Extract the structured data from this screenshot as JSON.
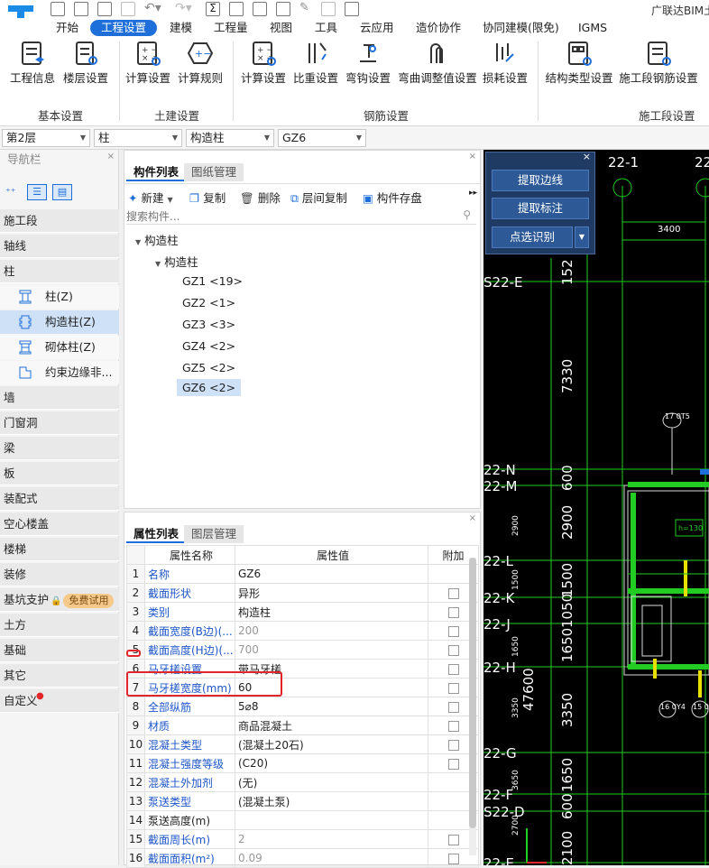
{
  "app_title": "广联达BIM土",
  "menu": {
    "tabs": [
      "开始",
      "工程设置",
      "建模",
      "工程量",
      "视图",
      "工具",
      "云应用",
      "造价协作",
      "协同建模(限免)",
      "IGMS"
    ],
    "active": "工程设置"
  },
  "ribbon": {
    "buttons": [
      "工程信息",
      "楼层设置",
      "计算设置",
      "计算规则",
      "计算设置",
      "比重设置",
      "弯钩设置",
      "弯曲调整值设置",
      "损耗设置",
      "结构类型设置",
      "施工段钢筋设置"
    ],
    "groups": [
      "基本设置",
      "土建设置",
      "钢筋设置",
      "施工段设置"
    ]
  },
  "filters": {
    "floor": "第2层",
    "type": "柱",
    "subtype": "构造柱",
    "item": "GZ6"
  },
  "nav": {
    "title": "导航栏",
    "categories_top": [
      "施工段",
      "轴线",
      "柱"
    ],
    "column_items": [
      "柱(Z)",
      "构造柱(Z)",
      "砌体柱(Z)",
      "约束边缘非..."
    ],
    "categories_bottom": [
      "墙",
      "门窗洞",
      "梁",
      "板",
      "装配式",
      "空心楼盖",
      "楼梯",
      "装修",
      "基坑支护",
      "土方",
      "基础",
      "其它",
      "自定义"
    ],
    "free_badge": "免费试用"
  },
  "complist": {
    "tabs": [
      "构件列表",
      "图纸管理"
    ],
    "toolbar": {
      "new": "新建",
      "copy": "复制",
      "delete": "删除",
      "floor_copy": "层间复制",
      "save": "构件存盘"
    },
    "search_placeholder": "搜索构件...",
    "tree_root": "构造柱",
    "tree_child": "构造柱",
    "items": [
      "GZ1 <19>",
      "GZ2 <1>",
      "GZ3 <3>",
      "GZ4 <2>",
      "GZ5 <2>",
      "GZ6 <2>"
    ]
  },
  "props": {
    "tabs": [
      "属性列表",
      "图层管理"
    ],
    "headers": [
      "属性名称",
      "属性值",
      "附加"
    ],
    "rows": [
      {
        "n": "1",
        "name": "名称",
        "value": "GZ6"
      },
      {
        "n": "2",
        "name": "截面形状",
        "value": "异形"
      },
      {
        "n": "3",
        "name": "类别",
        "value": "构造柱"
      },
      {
        "n": "4",
        "name": "截面宽度(B边)(...",
        "value": "200"
      },
      {
        "n": "5",
        "name": "截面高度(H边)(...",
        "value": "700"
      },
      {
        "n": "6",
        "name": "马牙槎设置",
        "value": "带马牙槎"
      },
      {
        "n": "7",
        "name": "马牙槎宽度(mm)",
        "value": "60"
      },
      {
        "n": "8",
        "name": "全部纵筋",
        "value": "5⌀8"
      },
      {
        "n": "9",
        "name": "材质",
        "value": "商品混凝土"
      },
      {
        "n": "10",
        "name": "混凝土类型",
        "value": "(混凝土20石)"
      },
      {
        "n": "11",
        "name": "混凝土强度等级",
        "value": "(C20)"
      },
      {
        "n": "12",
        "name": "混凝土外加剂",
        "value": "(无)"
      },
      {
        "n": "13",
        "name": "泵送类型",
        "value": "(混凝土泵)"
      },
      {
        "n": "14",
        "name": "泵送高度(m)",
        "value": ""
      },
      {
        "n": "15",
        "name": "截面周长(m)",
        "value": "2"
      },
      {
        "n": "16",
        "name": "截面面积(m²)",
        "value": "0.09"
      }
    ]
  },
  "float_panel": {
    "btn1": "提取边线",
    "btn2": "提取标注",
    "btn3": "点选识别"
  },
  "cad": {
    "axis_top": [
      "22-1",
      "22"
    ],
    "dim_top": "3400",
    "row_labels": [
      "S22-E",
      "22-N",
      "22-M",
      "22-L",
      "22-K",
      "22-J",
      "22-H",
      "22-G",
      "22-F",
      "S22-D",
      "22-E"
    ],
    "dims_big": [
      "152",
      "7330",
      "600",
      "2900",
      "1500",
      "1050",
      "1650",
      "3350",
      "47600",
      "1650",
      "600",
      "2100"
    ],
    "dims_small": [
      "2900",
      "1500",
      "1650",
      "3350",
      "3650",
      "2700"
    ],
    "bubbles": [
      "17\n0T5",
      "16\n0Y4",
      "15\n0Y4"
    ],
    "h_label": "h=130"
  }
}
